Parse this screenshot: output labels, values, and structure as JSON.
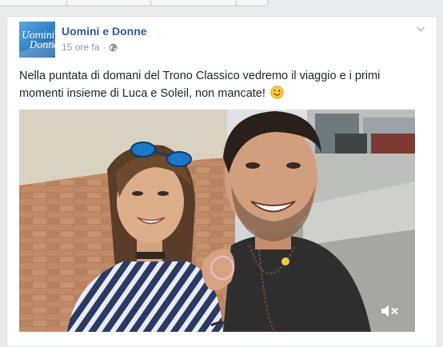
{
  "post": {
    "page_name": "Uomini e Donne",
    "timestamp": "15 ore fa",
    "separator": "·",
    "text": "Nella puntata di domani del Trono Classico vedremo il viaggio e i primi momenti insieme di Luca e Soleil, non mancate!",
    "avatar_logo_line1": "Uomini",
    "avatar_logo_line2": "Donne"
  },
  "icons": {
    "privacy": "globe-icon",
    "options": "chevron-down-icon",
    "emoji": "wink-emoji-icon",
    "video_sound": "speaker-muted-icon"
  },
  "colors": {
    "page_name": "#365899",
    "meta": "#90949c",
    "text": "#1d2129",
    "background": "#e9ebee"
  }
}
